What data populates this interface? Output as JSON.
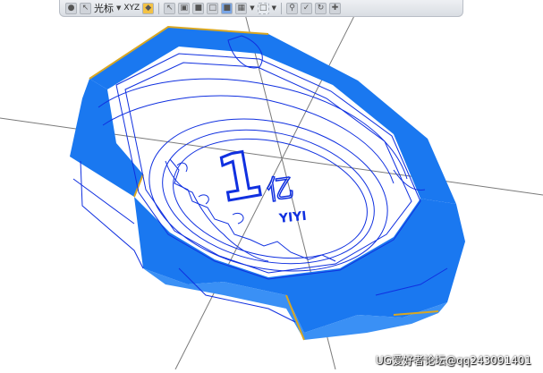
{
  "toolbar": {
    "filter_label": "光标",
    "csys_label": "XYZ",
    "icons": [
      "lock-icon",
      "select-arrow-icon",
      "filter-dropdown-icon",
      "csys-icon",
      "snap-point-icon",
      "select-cursor-icon",
      "cube-icon",
      "cube-shaded-icon",
      "cube-wire-icon",
      "shaded-edges-icon",
      "layer-icon",
      "box-select-icon",
      "zoom-icon",
      "check-icon",
      "rotate-icon",
      "pan-icon"
    ]
  },
  "model": {
    "emboss_number": "1",
    "emboss_char": "亿",
    "emboss_text": "YIYI"
  },
  "watermark": "UG爱好者论坛@qq243091401",
  "colors": {
    "face_blue": "#1a78f0",
    "wire_blue": "#1030e0",
    "edge_yellow": "#d9a722",
    "axis_gray": "#7a7a7a"
  }
}
